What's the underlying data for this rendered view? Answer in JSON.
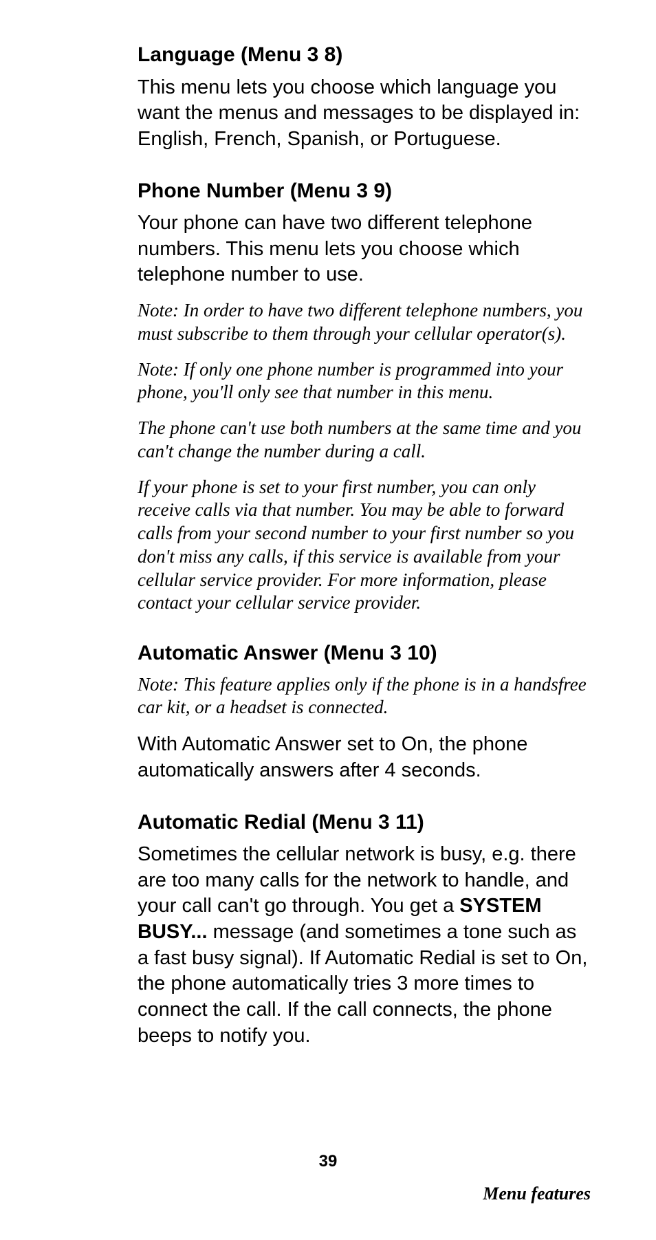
{
  "sections": [
    {
      "title": "Language (Menu 3 8)",
      "paragraphs": [
        {
          "type": "body",
          "text": "This menu lets you choose which language you want the menus and messages to be displayed in: English, French, Spanish, or Portuguese."
        }
      ]
    },
    {
      "title": "Phone Number (Menu 3 9)",
      "paragraphs": [
        {
          "type": "body",
          "text": "Your phone can have two different telephone numbers. This menu lets you choose which telephone number to use."
        },
        {
          "type": "note",
          "text": "Note: In order to have two different telephone numbers, you must subscribe to them through your cellular operator(s)."
        },
        {
          "type": "note",
          "text": "Note: If only one phone number is programmed into your phone, you'll only see that number in this menu."
        },
        {
          "type": "note",
          "text": "The phone can't use both numbers at the same time and you can't change the number during a call."
        },
        {
          "type": "note",
          "text": "If your phone is set to your first number, you can only receive calls via that number. You may be able to forward calls from your second number to your first number so you don't miss any calls, if this service is available from your cellular service provider. For more information, please contact your cellular service provider."
        }
      ]
    },
    {
      "title": "Automatic Answer (Menu 3 10)",
      "paragraphs": [
        {
          "type": "note",
          "text": "Note: This feature applies only if the phone is in a handsfree car kit, or a headset is connected."
        },
        {
          "type": "body",
          "text": "With Automatic Answer set to On, the phone automatically answers after 4 seconds."
        }
      ]
    },
    {
      "title": "Automatic Redial (Menu 3 11)",
      "paragraphs": [
        {
          "type": "body-mixed",
          "pre": "Sometimes the cellular network is busy, e.g. there are too many calls for the network to handle, and your call can't go through. You get a ",
          "bold": "SYSTEM BUSY...",
          "post": " message (and sometimes a tone such as a fast busy signal). If Automatic Redial is set to On, the phone automatically tries 3 more times to connect the call. If the call connects, the phone beeps to notify you."
        }
      ]
    }
  ],
  "page_number": "39",
  "footer": "Menu features"
}
